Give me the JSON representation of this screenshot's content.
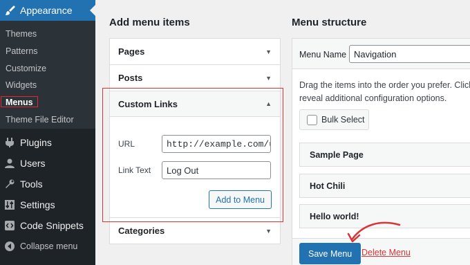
{
  "sidebar": {
    "appearance": "Appearance",
    "submenu": [
      "Themes",
      "Patterns",
      "Customize",
      "Widgets",
      "Menus",
      "Theme File Editor"
    ],
    "items": [
      "Plugins",
      "Users",
      "Tools",
      "Settings",
      "Code Snippets"
    ],
    "collapse": "Collapse menu"
  },
  "add_items": {
    "title": "Add menu items",
    "sections": [
      "Pages",
      "Posts",
      "Custom Links",
      "Categories"
    ],
    "url_label": "URL",
    "url_value": "http://example.com/u",
    "link_text_label": "Link Text",
    "link_text_value": "Log Out",
    "add_button": "Add to Menu"
  },
  "structure": {
    "title": "Menu structure",
    "menu_name_label": "Menu Name",
    "menu_name_value": "Navigation",
    "instructions_1": "Drag the items into the order you prefer. Click t",
    "instructions_2": "reveal additional configuration options.",
    "bulk_select": "Bulk Select",
    "items": [
      "Sample Page",
      "Hot Chili",
      "Hello world!"
    ],
    "save_button": "Save Menu",
    "delete_link": "Delete Menu"
  },
  "colors": {
    "accent": "#2271b1",
    "sidebar_bg": "#1d2327",
    "highlight": "#d63638"
  }
}
